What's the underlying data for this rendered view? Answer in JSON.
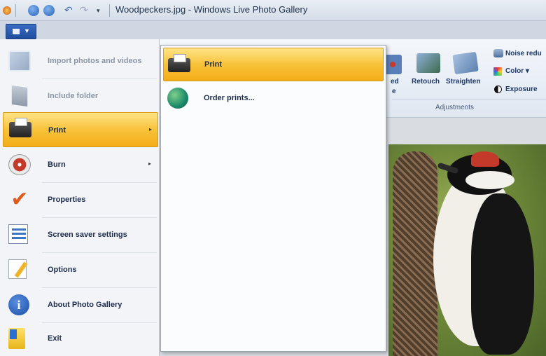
{
  "window": {
    "title": "Woodpeckers.jpg - Windows Live Photo Gallery"
  },
  "ribbon": {
    "items": [
      {
        "label": "ed",
        "icon": "red-eye-icon"
      },
      {
        "label": "Retouch",
        "icon": "retouch-icon"
      },
      {
        "label": "Straighten",
        "icon": "straighten-icon"
      },
      {
        "label": "Noise redu",
        "icon": "noise-reduction-icon"
      },
      {
        "label": "Color ▾",
        "icon": "color-icon"
      },
      {
        "label": "Exposure",
        "icon": "exposure-icon"
      }
    ],
    "partial_label": "e",
    "group_label": "Adjustments"
  },
  "app_menu": {
    "items": [
      {
        "label": "Import photos and videos",
        "icon": "import-photos-icon",
        "enabled": false
      },
      {
        "label": "Include folder",
        "icon": "folder-icon",
        "enabled": false
      },
      {
        "label": "Print",
        "icon": "printer-icon",
        "enabled": true,
        "submenu": true,
        "active": true
      },
      {
        "label": "Burn",
        "icon": "disc-icon",
        "enabled": true,
        "submenu": true
      },
      {
        "label": "Properties",
        "icon": "checkmark-icon",
        "enabled": true
      },
      {
        "label": "Screen saver settings",
        "icon": "screen-saver-icon",
        "enabled": true
      },
      {
        "label": "Options",
        "icon": "options-icon",
        "enabled": true
      },
      {
        "label": "About Photo Gallery",
        "icon": "info-icon",
        "enabled": true
      },
      {
        "label": "Exit",
        "icon": "exit-icon",
        "enabled": true
      }
    ],
    "submenu_arrow": "▸"
  },
  "print_submenu": {
    "items": [
      {
        "label": "Print",
        "icon": "printer-icon",
        "active": true
      },
      {
        "label": "Order prints...",
        "icon": "globe-icon",
        "active": false
      }
    ]
  },
  "colors": {
    "highlight": "#f8c23a",
    "app_button": "#2a5bb0",
    "menu_background": "#f2f4f7"
  }
}
